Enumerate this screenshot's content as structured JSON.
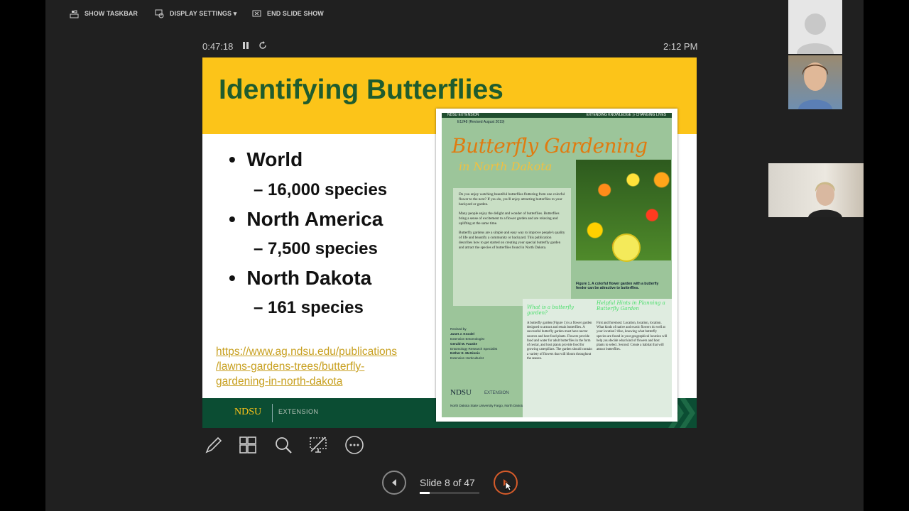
{
  "toolbar": {
    "show_taskbar": "SHOW TASKBAR",
    "display_settings": "DISPLAY SETTINGS ▾",
    "end_slide_show": "END SLIDE SHOW"
  },
  "presenter": {
    "elapsed": "0:47:18",
    "clock": "2:12 PM",
    "slide_counter": "Slide 8 of 47",
    "progress_fraction": 0.17
  },
  "slide": {
    "title": "Identifying Butterflies",
    "bullets": [
      {
        "label": "World",
        "sub": "16,000 species"
      },
      {
        "label": "North America",
        "sub": "7,500 species"
      },
      {
        "label": "North Dakota",
        "sub": "161 species"
      }
    ],
    "link": "https://www.ag.ndsu.edu/publications/lawns-gardens-trees/butterfly-gardening-in-north-dakota",
    "link_lines": [
      "https://www.ag.ndsu.edu/publications",
      "/lawns-gardens-trees/butterfly-",
      "gardening-in-north-dakota"
    ],
    "footer_brand": "NDSU",
    "footer_ext": "EXTENSION"
  },
  "pamphlet": {
    "top_left": "NDSU EXTENSION",
    "top_right": "EXTENDING KNOWLEDGE ⟩⟩ CHANGING LIVES",
    "code": "E1248 (Revised August 2019)",
    "title1": "Butterfly Gardening",
    "title2": "in North Dakota",
    "para1": "Do you enjoy watching beautiful butterflies fluttering from one colorful flower to the next? If you do, you'll enjoy attracting butterflies to your backyard or garden.",
    "para2": "Many people enjoy the delight and wonder of butterflies. Butterflies bring a sense of excitement to a flower garden and are relaxing and uplifting at the same time.",
    "para3": "Butterfly gardens are a simple and easy way to improve people's quality of life and beautify a community or backyard. This publication describes how to get started on creating your special butterfly garden and attract the species of butterflies found in North Dakota.",
    "caption": "Figure 1. A colorful flower garden with a butterfly feeder can be attractive to butterflies.",
    "heading1": "What is a butterfly garden?",
    "heading2": "Helpful Hints in Planning a Butterfly Garden",
    "col1": "A butterfly garden (Figure 1) is a flower garden designed to attract and retain butterflies. A successful butterfly garden must have nectar sources and host food plants. Flowers provide food and water for adult butterflies in the form of nectar, and host plants provide food for growing caterpillars. The garden should contain a variety of flowers that will bloom throughout the season.",
    "col2": "First and foremost: Location, location, location. What kinds of native and exotic flowers do well at your location? Also, knowing what butterfly species are found in your geographical location will help you decide what kind of flowers and host plants to select. Second: Create a habitat that will attract butterflies.",
    "credits": [
      "Revised by",
      "Janet J. Knodel",
      "Extension Entomologist",
      "Gerald M. Fauske",
      "Entomology Research Specialist",
      "Esther E. McGinnis",
      "Extension Horticulturist"
    ],
    "ndsu": "NDSU",
    "extension": "EXTENSION",
    "address": "North Dakota State University Fargo, North Dakota"
  },
  "tools": [
    "pen-icon",
    "see-all-slides-icon",
    "zoom-icon",
    "black-screen-icon",
    "more-options-icon"
  ],
  "colors": {
    "banner": "#fcc419",
    "title": "#1f5c2e",
    "footer": "#0b4d33",
    "next_ring": "#d55b2a"
  }
}
